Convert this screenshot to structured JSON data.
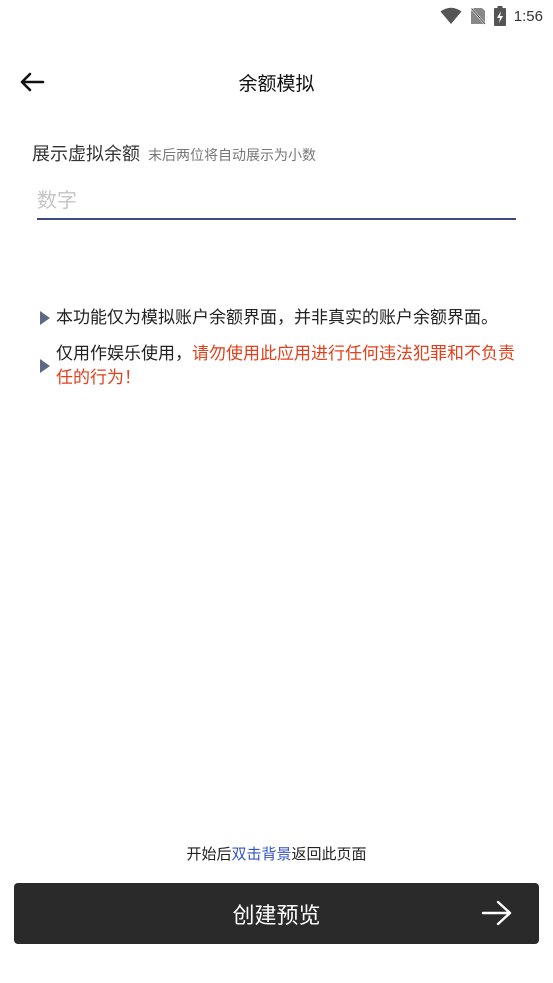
{
  "status_bar": {
    "time": "1:56",
    "icons": [
      "wifi-icon",
      "no-sim-icon",
      "battery-charging-icon"
    ]
  },
  "toolbar": {
    "title": "余额模拟",
    "back_icon": "arrow-left-icon"
  },
  "form": {
    "label": "展示虚拟余额",
    "hint": "末后两位将自动展示为小数",
    "input_placeholder": "数字",
    "input_value": "",
    "underline_color": "#3c4a82"
  },
  "notes": [
    {
      "text": "本功能仅为模拟账户余额界面，并非真实的账户余额界面。"
    },
    {
      "text": "仅用作娱乐使用，",
      "warning": "请勿使用此应用进行任何违法犯罪和不负责任的行为！"
    }
  ],
  "colors": {
    "warning": "#e0401c",
    "link": "#3454c8",
    "button_bg": "#2a2a2a"
  },
  "tip": {
    "prefix": "开始后",
    "link": "双击背景",
    "suffix": "返回此页面"
  },
  "create_button": {
    "label": "创建预览",
    "icon": "arrow-right-icon"
  }
}
